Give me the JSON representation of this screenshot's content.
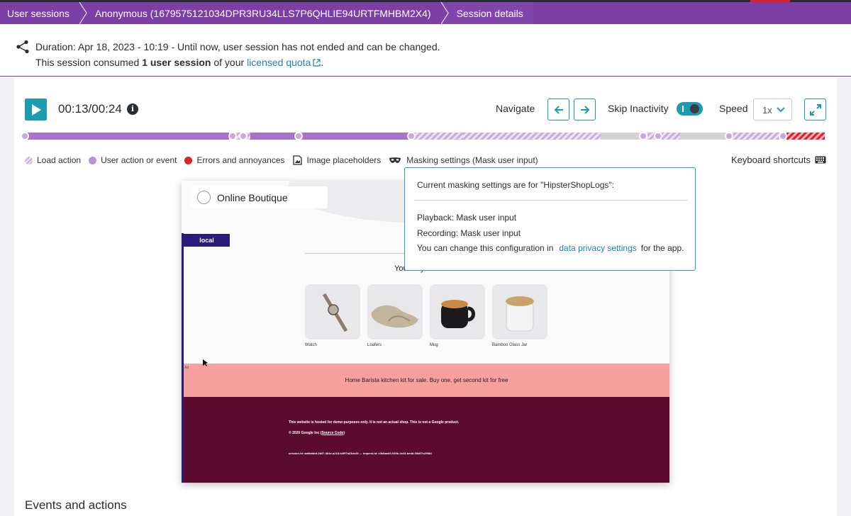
{
  "breadcrumbs": [
    {
      "label": "User sessions"
    },
    {
      "label": "Anonymous (1679575121034DPR3RU34LLS7P6QHLIE94URTFMHBM2X4)"
    },
    {
      "label": "Session details"
    }
  ],
  "header": {
    "duration_text": "Duration: Apr 18, 2023 - 10:19 - Until now, user session has not ended and can be changed.",
    "consumed_prefix": "This session consumed ",
    "consumed_bold": "1 user session",
    "consumed_mid": " of your ",
    "quota_link": "licensed quota",
    "consumed_suffix": "."
  },
  "player": {
    "time": "00:13/00:24",
    "info_glyph": "i",
    "navigate_label": "Navigate",
    "skip_inactivity_label": "Skip Inactivity",
    "skip_inactivity_on": true,
    "speed_label": "Speed",
    "speed_value": "1x"
  },
  "legend": {
    "load_action": "Load action",
    "user_action": "User action or event",
    "errors": "Errors and annoyances",
    "image_placeholders": "Image placeholders",
    "masking": "Masking settings (Mask user input)",
    "keyboard_shortcuts": "Keyboard shortcuts"
  },
  "replay": {
    "brand": "Online Boutique",
    "env_tag": "local",
    "recommend_heading": "You may also like",
    "products": [
      {
        "name": "Watch"
      },
      {
        "name": "Loafers"
      },
      {
        "name": "Mug"
      },
      {
        "name": "Bamboo Glass Jar"
      }
    ],
    "ad_label": "Ad",
    "promo": "Home Barista kitchen kit for sale. Buy one, get second kit for free",
    "footer_line1": "This website is hosted for demo purposes only. It is not an actual shop. This is not a Google product.",
    "footer_copyright": "© 2020 Google Inc (",
    "footer_source": "Source Code",
    "footer_close": ")",
    "footer_ids": "session-id: aafdabbd-2b37-464e-a218-b4f97a23dc45 — request-id: e3b6aed3-049b-4e23-bedd-39d07c29f8d"
  },
  "masking_popover": {
    "title": "Current masking settings are for \"HipsterShopLogs\":",
    "playback": "Playback: Mask user input",
    "recording": "Recording: Mask user input",
    "change_prefix": "You can change this configuration in",
    "link": "data privacy settings",
    "change_suffix": "for the app."
  },
  "events_title": "Events and actions",
  "colors": {
    "brand_purple": "#7b3fa6",
    "accent_teal": "#1d9baf",
    "user_action": "#b790d5",
    "error": "#d8232a"
  }
}
